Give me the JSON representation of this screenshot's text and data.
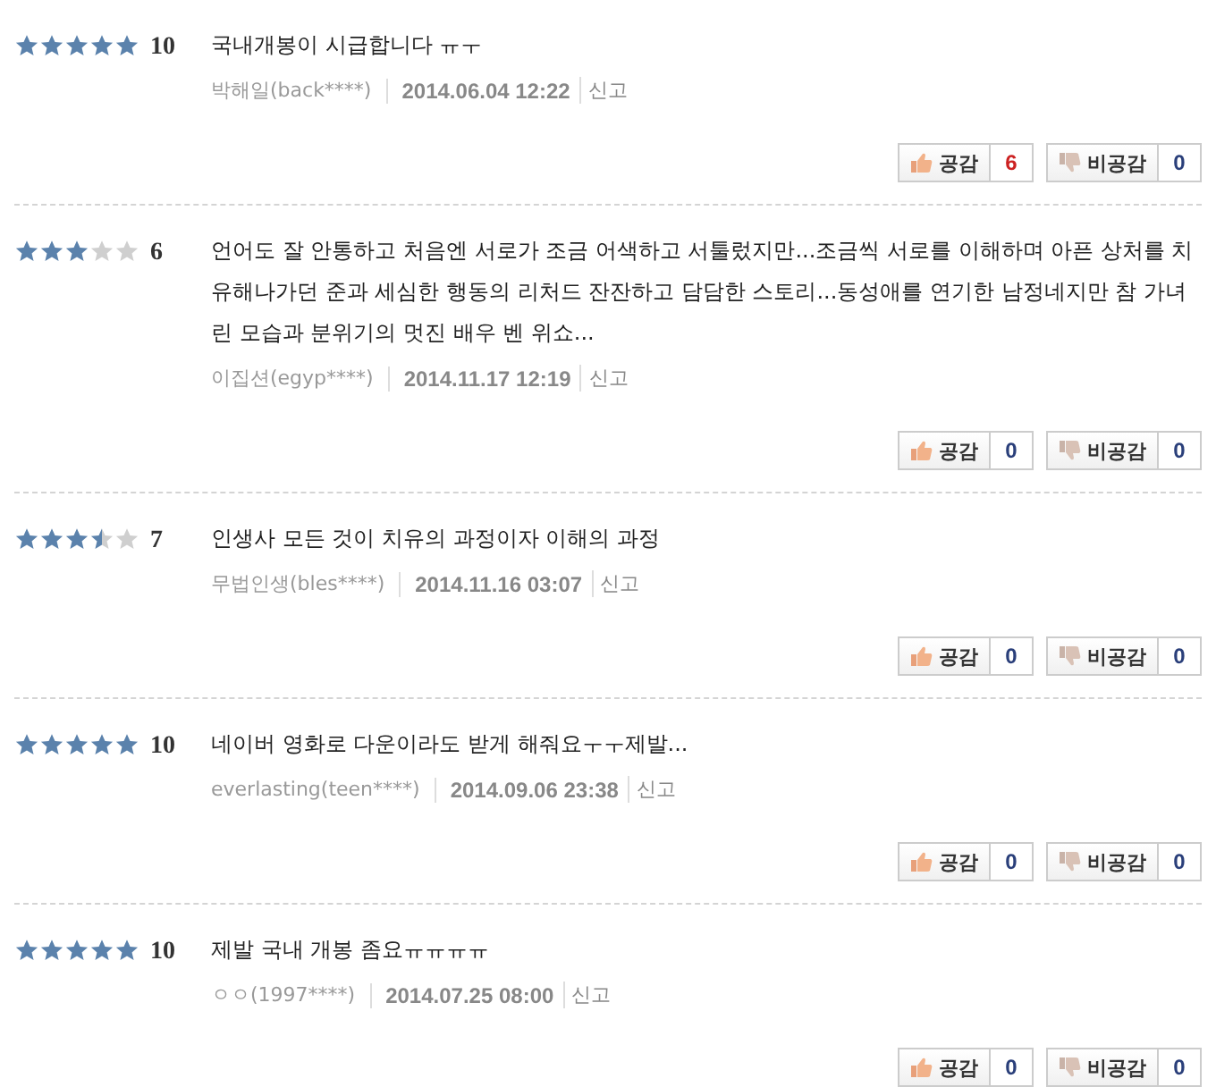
{
  "reviews": [
    {
      "stars": 5,
      "score": "10",
      "text": "국내개봉이 시급합니다 ㅠㅜ",
      "author": "박해일(back****)",
      "date": "2014.06.04 12:22",
      "report": "신고",
      "like_label": "공감",
      "likes": "6",
      "dislike_label": "비공감",
      "dislikes": "0"
    },
    {
      "stars": 3,
      "score": "6",
      "text": "언어도 잘 안통하고 처음엔 서로가 조금 어색하고 서툴렀지만...조금씩 서로를 이해하며 아픈 상처를 치유해나가던 준과 세심한 행동의 리처드 잔잔하고 담담한 스토리...동성애를 연기한 남정네지만 참 가녀린 모습과 분위기의 멋진 배우 벤 위쇼...",
      "author": "이집션(egyp****)",
      "date": "2014.11.17 12:19",
      "report": "신고",
      "like_label": "공감",
      "likes": "0",
      "dislike_label": "비공감",
      "dislikes": "0"
    },
    {
      "stars": 3.5,
      "score": "7",
      "text": "인생사 모든 것이 치유의 과정이자 이해의 과정",
      "author": "무법인생(bles****)",
      "date": "2014.11.16 03:07",
      "report": "신고",
      "like_label": "공감",
      "likes": "0",
      "dislike_label": "비공감",
      "dislikes": "0"
    },
    {
      "stars": 5,
      "score": "10",
      "text": "네이버 영화로 다운이라도 받게 해줘요ㅜㅜ제발...",
      "author": "everlasting(teen****)",
      "date": "2014.09.06 23:38",
      "report": "신고",
      "like_label": "공감",
      "likes": "0",
      "dislike_label": "비공감",
      "dislikes": "0"
    },
    {
      "stars": 5,
      "score": "10",
      "text": "제발 국내 개봉 좀요ㅠㅠㅠㅠ",
      "author": "ㅇㅇ(1997****)",
      "date": "2014.07.25 08:00",
      "report": "신고",
      "like_label": "공감",
      "likes": "0",
      "dislike_label": "비공감",
      "dislikes": "0"
    }
  ]
}
